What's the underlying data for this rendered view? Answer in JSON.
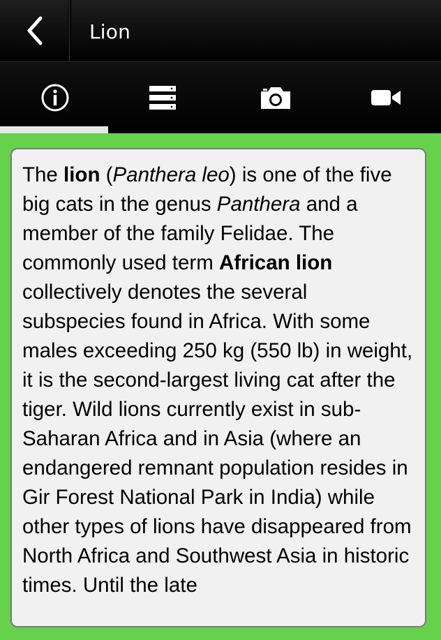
{
  "header": {
    "title": "Lion",
    "back_icon": "chevron-left-icon"
  },
  "tabs": [
    {
      "name": "info",
      "icon": "info-icon",
      "selected": true
    },
    {
      "name": "list",
      "icon": "list-icon",
      "selected": false
    },
    {
      "name": "photos",
      "icon": "camera-icon",
      "selected": false
    },
    {
      "name": "videos",
      "icon": "video-camera-icon",
      "selected": false
    }
  ],
  "colors": {
    "background": "#66d14a",
    "bar": "#000000",
    "panel": "#f1f1f1",
    "indicator": "#e7e7e7"
  },
  "article": {
    "s1": "The ",
    "s2": "lion",
    "s3": " (",
    "s4": "Panthera leo",
    "s5": ") is one of the five big cats in the genus ",
    "s6": "Panthera",
    "s7": " and a member of the family Felidae. The commonly used term ",
    "s8": "African lion",
    "s9": " collectively denotes the several subspecies found in Africa. With some males exceeding 250 kg (550 lb) in weight, it is the second-largest living cat after the tiger. Wild lions currently exist in sub-Saharan Africa and in Asia (where an endangered remnant population resides in Gir Forest National Park in India) while other types of lions have disappeared from North Africa and Southwest Asia in historic times. Until the late"
  }
}
